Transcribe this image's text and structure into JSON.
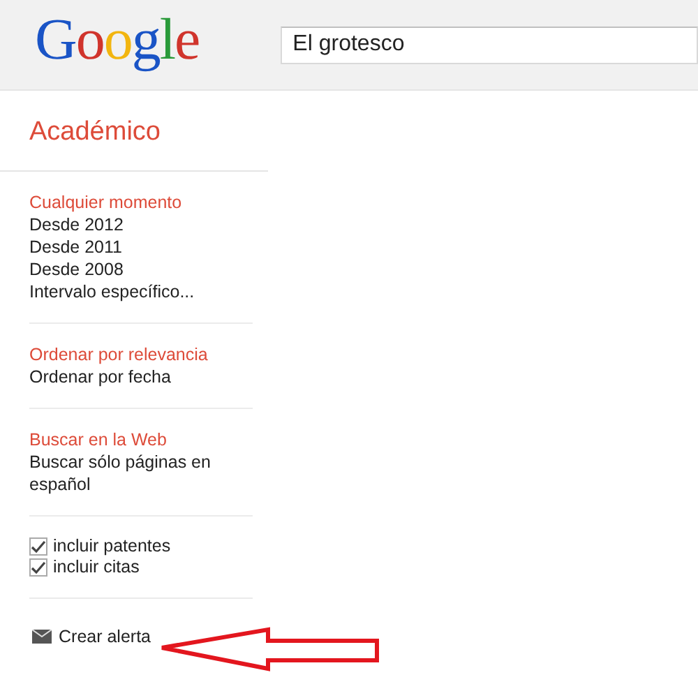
{
  "header": {
    "logo": "Google",
    "search": {
      "value": "El grotesco"
    }
  },
  "sidebar": {
    "title": "Académico",
    "groups": [
      {
        "items": [
          {
            "label": "Cualquier momento",
            "selected": true
          },
          {
            "label": "Desde 2012",
            "selected": false
          },
          {
            "label": "Desde 2011",
            "selected": false
          },
          {
            "label": "Desde 2008",
            "selected": false
          },
          {
            "label": "Intervalo específico...",
            "selected": false
          }
        ]
      },
      {
        "items": [
          {
            "label": "Ordenar por relevancia",
            "selected": true
          },
          {
            "label": "Ordenar por fecha",
            "selected": false
          }
        ]
      },
      {
        "items": [
          {
            "label": "Buscar en la Web",
            "selected": true
          },
          {
            "label": "Buscar sólo páginas en español",
            "selected": false
          }
        ]
      }
    ],
    "options": [
      {
        "label": "incluir patentes",
        "checked": true
      },
      {
        "label": "incluir citas",
        "checked": true
      }
    ],
    "alert": {
      "label": "Crear alerta"
    }
  }
}
